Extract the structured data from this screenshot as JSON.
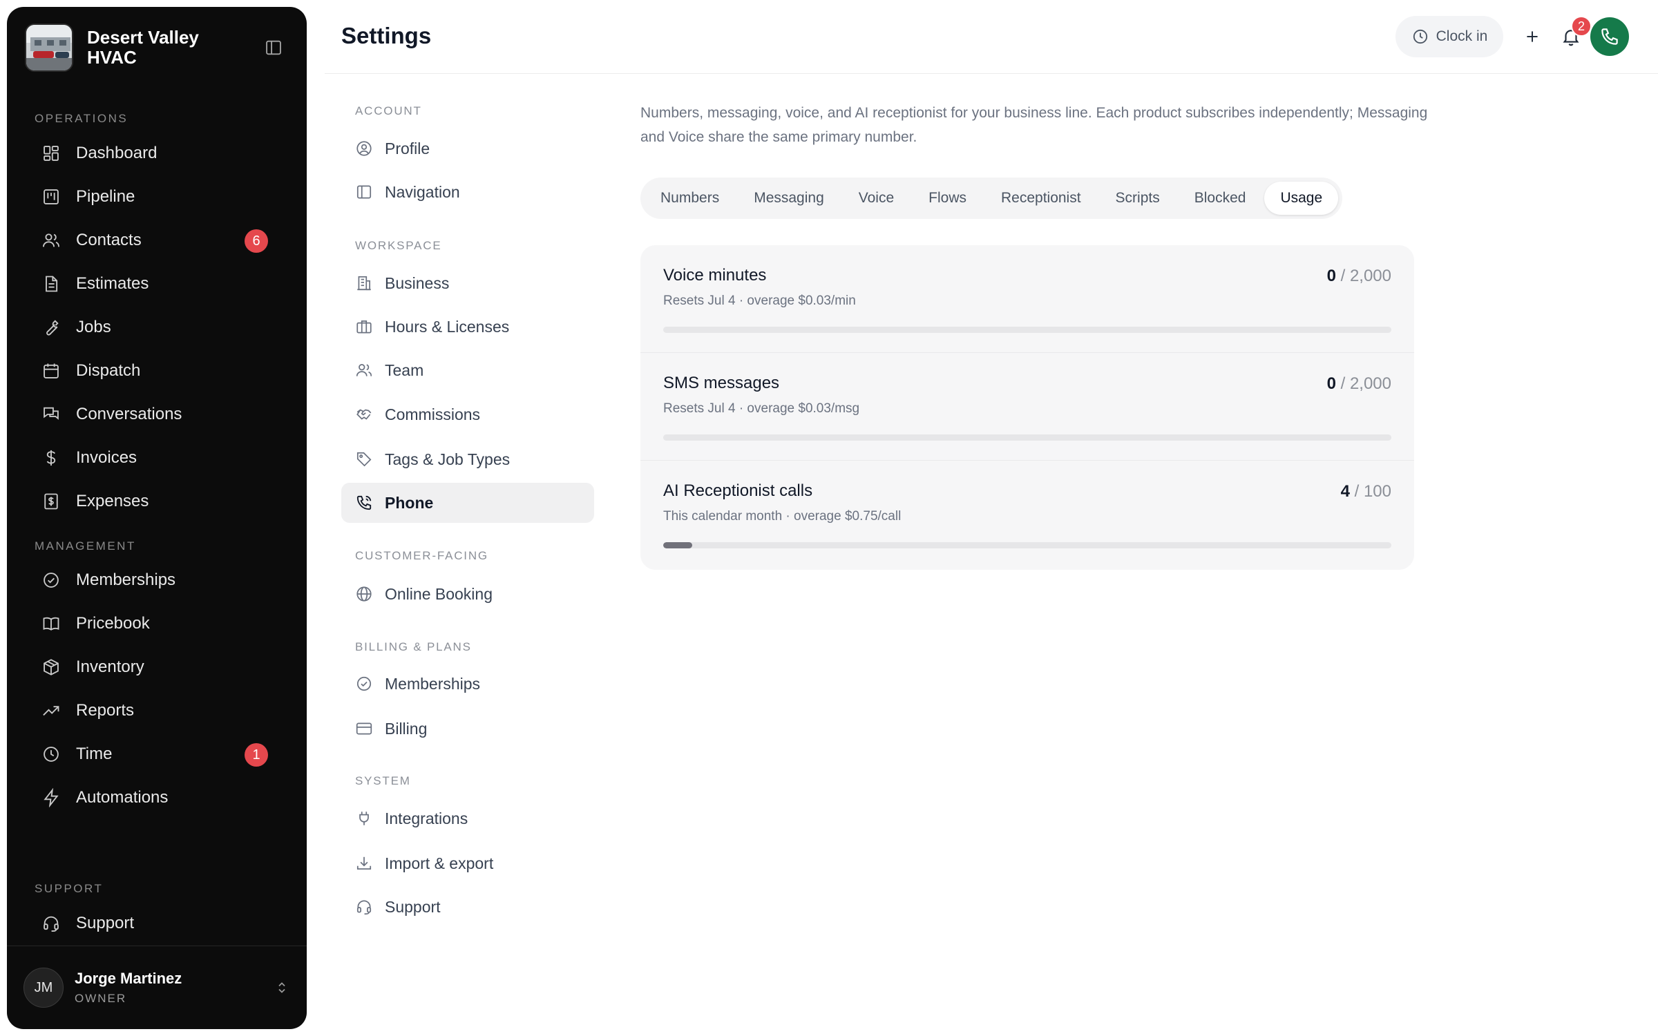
{
  "sidebar": {
    "brand": "Desert Valley HVAC",
    "sections": {
      "operations": "OPERATIONS",
      "management": "MANAGEMENT",
      "support": "SUPPORT"
    },
    "items": [
      {
        "label": "Dashboard",
        "icon": "dashboard-icon"
      },
      {
        "label": "Pipeline",
        "icon": "kanban-icon"
      },
      {
        "label": "Contacts",
        "icon": "users-icon",
        "badge": "6"
      },
      {
        "label": "Estimates",
        "icon": "document-icon"
      },
      {
        "label": "Jobs",
        "icon": "wrench-icon"
      },
      {
        "label": "Dispatch",
        "icon": "calendar-icon"
      },
      {
        "label": "Conversations",
        "icon": "chat-icon"
      },
      {
        "label": "Invoices",
        "icon": "dollar-icon"
      },
      {
        "label": "Expenses",
        "icon": "receipt-icon"
      },
      {
        "label": "Memberships",
        "icon": "badge-check-icon"
      },
      {
        "label": "Pricebook",
        "icon": "book-icon"
      },
      {
        "label": "Inventory",
        "icon": "box-icon"
      },
      {
        "label": "Reports",
        "icon": "trend-icon"
      },
      {
        "label": "Time",
        "icon": "clock-icon",
        "badge": "1"
      },
      {
        "label": "Automations",
        "icon": "bolt-icon"
      },
      {
        "label": "Support",
        "icon": "headset-icon"
      }
    ],
    "user": {
      "initials": "JM",
      "name": "Jorge Martinez",
      "role": "OWNER"
    }
  },
  "header": {
    "title": "Settings",
    "clock_in": "Clock in",
    "notification_count": "2"
  },
  "settings_nav": {
    "sections": {
      "account": "ACCOUNT",
      "workspace": "WORKSPACE",
      "customer": "CUSTOMER-FACING",
      "billing": "BILLING & PLANS",
      "system": "SYSTEM"
    },
    "items": [
      {
        "label": "Profile",
        "icon": "user-circle-icon"
      },
      {
        "label": "Navigation",
        "icon": "sidebar-icon"
      },
      {
        "label": "Business",
        "icon": "building-icon"
      },
      {
        "label": "Hours & Licenses",
        "icon": "briefcase-icon"
      },
      {
        "label": "Team",
        "icon": "team-icon"
      },
      {
        "label": "Commissions",
        "icon": "handshake-icon"
      },
      {
        "label": "Tags & Job Types",
        "icon": "tag-icon"
      },
      {
        "label": "Phone",
        "icon": "phone-icon",
        "active": true
      },
      {
        "label": "Online Booking",
        "icon": "globe-icon"
      },
      {
        "label": "Memberships",
        "icon": "badge-check-icon"
      },
      {
        "label": "Billing",
        "icon": "credit-card-icon"
      },
      {
        "label": "Integrations",
        "icon": "plug-icon"
      },
      {
        "label": "Import & export",
        "icon": "download-icon"
      },
      {
        "label": "Support",
        "icon": "headset-icon"
      }
    ]
  },
  "main": {
    "description": "Numbers, messaging, voice, and AI receptionist for your business line. Each product subscribes independently; Messaging and Voice share the same primary number.",
    "tabs": [
      "Numbers",
      "Messaging",
      "Voice",
      "Flows",
      "Receptionist",
      "Scripts",
      "Blocked",
      "Usage"
    ],
    "active_tab": "Usage",
    "usage": [
      {
        "title": "Voice minutes",
        "subtitle": "Resets Jul 4 · overage $0.03/min",
        "used": "0",
        "limit": "2,000",
        "fraction": 0
      },
      {
        "title": "SMS messages",
        "subtitle": "Resets Jul 4 · overage $0.03/msg",
        "used": "0",
        "limit": "2,000",
        "fraction": 0
      },
      {
        "title": "AI Receptionist calls",
        "subtitle": "This calendar month · overage $0.75/call",
        "used": "4",
        "limit": "100",
        "fraction": 0.04
      }
    ]
  }
}
